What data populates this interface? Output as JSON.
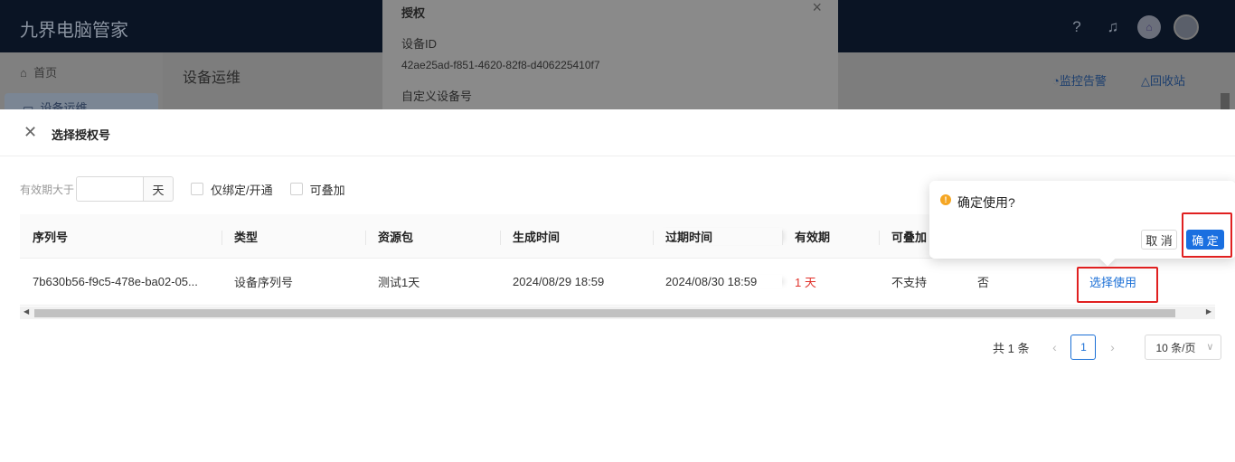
{
  "app": {
    "brand": "九界电脑管家",
    "sidebar": {
      "home": "首页",
      "devices": "设备运维"
    },
    "page_title": "设备运维",
    "monitor_label": "监控告警",
    "recycle_label": "回收站"
  },
  "auth_panel": {
    "title": "授权",
    "device_id_label": "设备ID",
    "device_id_value": "42ae25ad-f851-4620-82f8-d406225410f7",
    "custom_no_label": "自定义设备号"
  },
  "drawer": {
    "title": "选择授权号",
    "filter": {
      "validity_label": "有效期大于",
      "validity_value": "",
      "validity_suffix": "天",
      "bound_only_label": "仅绑定/开通",
      "stackable_label": "可叠加"
    },
    "table": {
      "columns": [
        "序列号",
        "类型",
        "资源包",
        "生成时间",
        "过期时间",
        "有效期",
        "可叠加"
      ],
      "rows": [
        {
          "serial": "7b630b56-f9c5-478e-ba02-05...",
          "type": "设备序列号",
          "package": "测试1天",
          "created": "2024/08/29 18:59",
          "expires": "2024/08/30 18:59",
          "validity": "1 天",
          "stackable": "不支持",
          "extra": "否",
          "action": "选择使用"
        }
      ]
    },
    "pagination": {
      "total": "共 1 条",
      "current_page": "1",
      "page_size": "10 条/页"
    }
  },
  "popconfirm": {
    "message": "确定使用?",
    "cancel_label": "取 消",
    "ok_label": "确 定"
  },
  "colors": {
    "primary": "#1a6fd6",
    "danger": "#e0322b",
    "highlight": "#e02020",
    "warning": "#f5a623"
  }
}
